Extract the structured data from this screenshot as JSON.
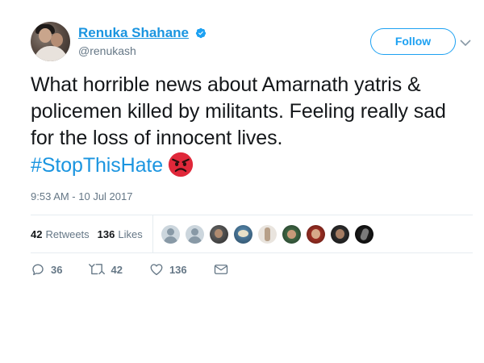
{
  "author": {
    "display_name": "Renuka Shahane",
    "handle": "@renukash",
    "verified": true
  },
  "follow_label": "Follow",
  "tweet": {
    "text": "What horrible news about Amarnath yatris & policemen killed by militants. Feeling really sad for the loss of innocent lives.",
    "hashtag": "#StopThisHate",
    "emoji": "angry-face-icon",
    "timestamp": "9:53 AM - 10 Jul 2017"
  },
  "stats": {
    "retweets_count": "42",
    "retweets_label": "Retweets",
    "likes_count": "136",
    "likes_label": "Likes"
  },
  "actions": {
    "replies": "36",
    "retweets": "42",
    "likes": "136"
  },
  "colors": {
    "accent": "#1da1f2",
    "link": "#1b95e0",
    "text": "#14171a",
    "muted": "#657786",
    "angry_emoji": "#e0283a"
  }
}
